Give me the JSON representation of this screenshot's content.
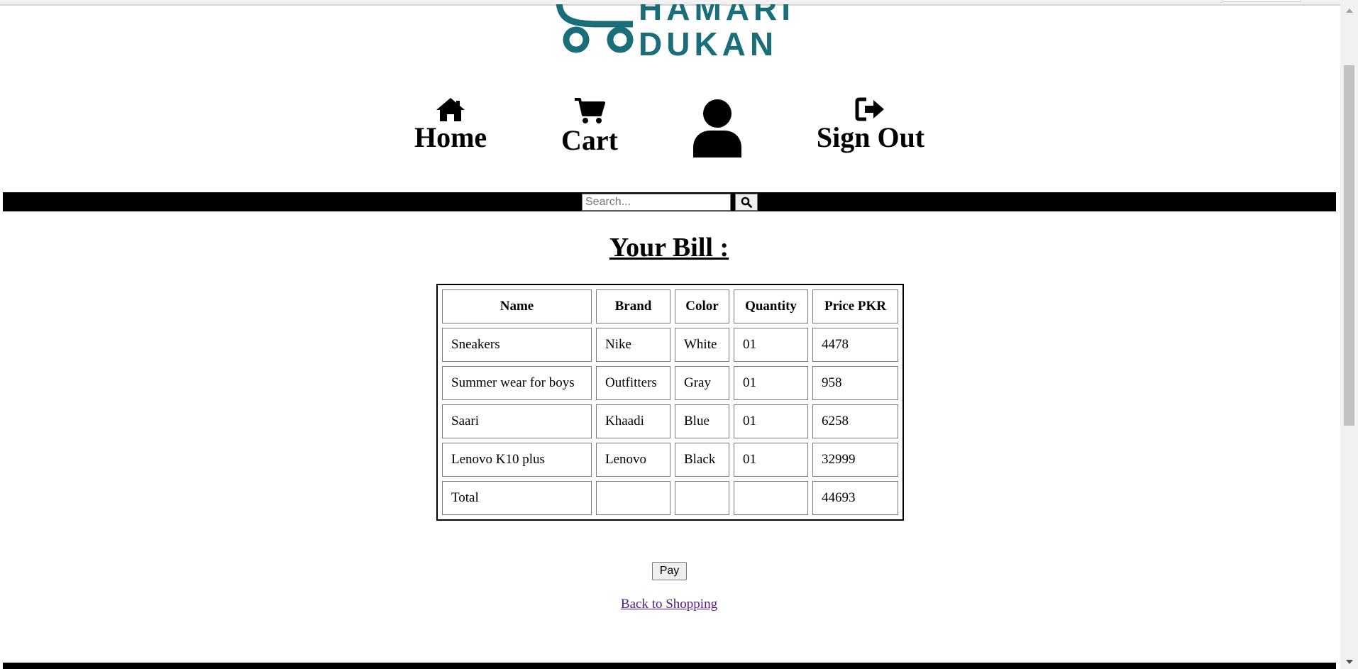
{
  "logo": {
    "text_top": "HAMARI",
    "text_bottom": "DUKAN",
    "brand_color": "#1a6e7a"
  },
  "nav": {
    "home": {
      "label": "Home",
      "icon": "home-icon"
    },
    "cart": {
      "label": "Cart",
      "icon": "cart-icon"
    },
    "profile": {
      "icon": "user-icon"
    },
    "signout": {
      "label": "Sign Out",
      "icon": "sign-out-icon"
    }
  },
  "search": {
    "placeholder": "Search...",
    "value": "",
    "button_icon": "search-icon"
  },
  "bill": {
    "title": "Your Bill :",
    "headers": {
      "name": "Name",
      "brand": "Brand",
      "color": "Color",
      "quantity": "Quantity",
      "price": "Price PKR"
    },
    "rows": [
      {
        "name": "Sneakers",
        "brand": "Nike",
        "color": "White",
        "quantity": "01",
        "price": "4478"
      },
      {
        "name": "Summer wear for boys",
        "brand": "Outfitters",
        "color": "Gray",
        "quantity": "01",
        "price": "958"
      },
      {
        "name": "Saari",
        "brand": "Khaadi",
        "color": "Blue",
        "quantity": "01",
        "price": "6258"
      },
      {
        "name": "Lenovo K10 plus",
        "brand": "Lenovo",
        "color": "Black",
        "quantity": "01",
        "price": "32999"
      }
    ],
    "total": {
      "label": "Total",
      "brand": "",
      "color": "",
      "quantity": "",
      "price": "44693"
    }
  },
  "actions": {
    "pay_label": "Pay",
    "back_label": "Back to Shopping",
    "link_color": "#551a8b"
  }
}
